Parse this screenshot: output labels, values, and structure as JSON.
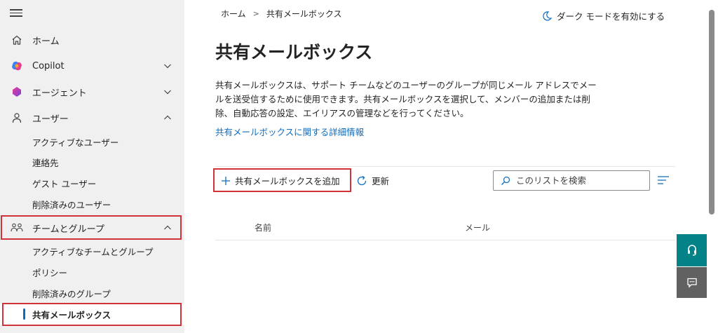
{
  "sidebar": {
    "items": [
      {
        "label": "ホーム",
        "icon": "home-icon"
      },
      {
        "label": "Copilot",
        "icon": "copilot-icon"
      },
      {
        "label": "エージェント",
        "icon": "agent-icon"
      },
      {
        "label": "ユーザー",
        "icon": "user-icon"
      }
    ],
    "users_sub": [
      "アクティブなユーザー",
      "連絡先",
      "ゲスト ユーザー",
      "削除済みのユーザー"
    ],
    "teams": {
      "label": "チームとグループ",
      "icon": "teams-groups-icon"
    },
    "teams_sub": [
      "アクティブなチームとグループ",
      "ポリシー",
      "削除済みのグループ",
      "共有メールボックス"
    ]
  },
  "breadcrumb": {
    "home": "ホーム",
    "separator": ">",
    "current": "共有メールボックス"
  },
  "dark_mode": {
    "label": "ダーク モードを有効にする"
  },
  "page": {
    "title": "共有メールボックス",
    "description_lines": [
      "共有メールボックスは、サポート チームなどのユーザーのグループが同じメール アドレスでメー",
      "ルを送受信するために使用できます。共有メールボックスを選択して、メンバーの追加または削",
      "除、自動応答の設定、エイリアスの管理などを行ってください。"
    ],
    "learn_more": "共有メールボックスに関する詳細情報"
  },
  "toolbar": {
    "add_label": "共有メールボックスを追加",
    "refresh_label": "更新",
    "search_placeholder": "このリストを検索"
  },
  "table": {
    "columns": [
      "名前",
      "メール"
    ]
  },
  "colors": {
    "accent": "#0f6cbd",
    "highlight_border": "#d13438",
    "help_button": "#038387",
    "feedback_button": "#616161"
  }
}
